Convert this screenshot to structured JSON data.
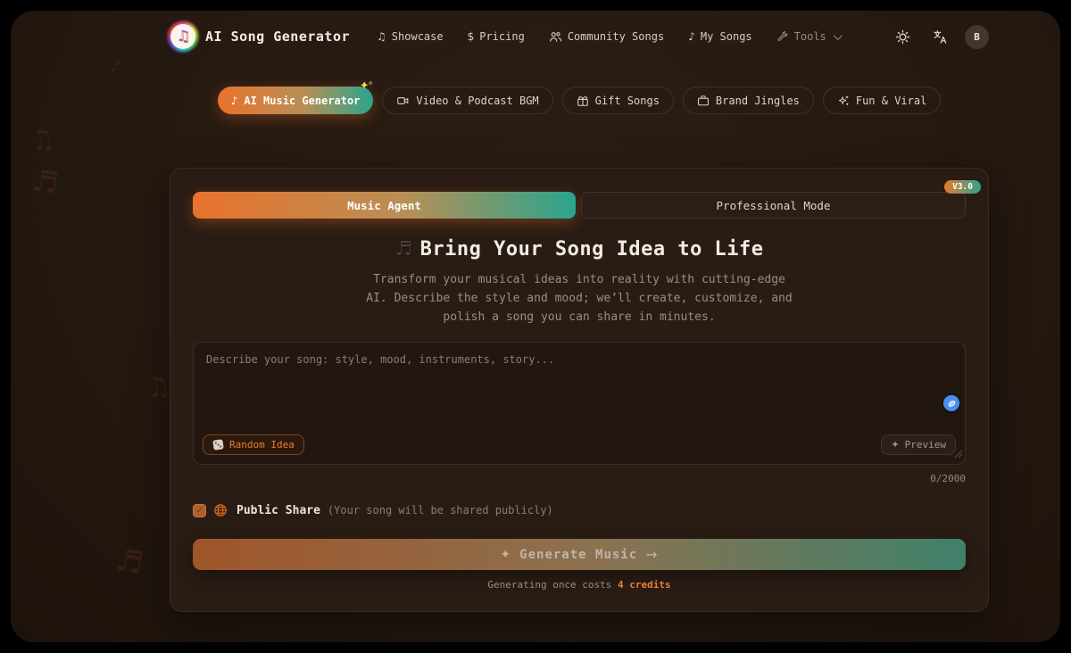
{
  "colors": {
    "accent_orange": "#e8722c",
    "accent_teal": "#2aa58e",
    "credits_highlight": "#e87f33",
    "page_background": "#261a11",
    "card_background": "#291c14"
  },
  "icons": {
    "sparkle": "✦",
    "note_eighth": "♪",
    "note_beamed": "♫",
    "note_heading": "♬",
    "dollar": "$"
  },
  "header": {
    "brand_title": "AI Song Generator",
    "logo_glyph": "♫",
    "nav": [
      {
        "icon": "beamed-notes",
        "glyph": "♫",
        "label": "Showcase"
      },
      {
        "icon": "dollar-sign",
        "glyph": "$",
        "label": "Pricing"
      },
      {
        "icon": "users",
        "label": "Community Songs"
      },
      {
        "icon": "music-note",
        "glyph": "♪",
        "label": "My Songs"
      },
      {
        "icon": "wrench",
        "label": "Tools"
      }
    ],
    "avatar_initial": "B"
  },
  "tabs": [
    {
      "label": "AI Music Generator",
      "icon": "music-note",
      "glyph": "♪",
      "active": true
    },
    {
      "label": "Video & Podcast BGM",
      "icon": "video-camera",
      "active": false
    },
    {
      "label": "Gift Songs",
      "icon": "gift",
      "active": false
    },
    {
      "label": "Brand Jingles",
      "icon": "briefcase",
      "active": false
    },
    {
      "label": "Fun & Viral",
      "icon": "sparkles",
      "active": false
    }
  ],
  "card": {
    "version_badge": "V3.0",
    "modes": [
      {
        "label": "Music Agent",
        "active": true
      },
      {
        "label": "Professional Mode",
        "active": false
      }
    ],
    "heading": {
      "icon_glyph": "♬",
      "text": "Bring Your Song Idea to Life"
    },
    "description_lines": [
      "Transform your musical ideas into reality with cutting-edge",
      "AI. Describe the style and mood; we’ll create, customize, and",
      "polish a song you can share in minutes."
    ],
    "prompt": {
      "placeholder": "Describe your song: style, mood, instruments, story...",
      "value": "",
      "random_idea_label": "Random Idea",
      "preview_label": "Preview",
      "counter": "0/2000"
    },
    "public_share": {
      "checked": true,
      "check_glyph": "✓",
      "label": "Public Share",
      "hint": "(Your song will be shared publicly)"
    },
    "generate": {
      "sparkle": "✦",
      "label": "Generate Music",
      "arrow": "→"
    },
    "credits": {
      "prefix": "Generating once costs ",
      "highlight": "4 credits"
    }
  }
}
